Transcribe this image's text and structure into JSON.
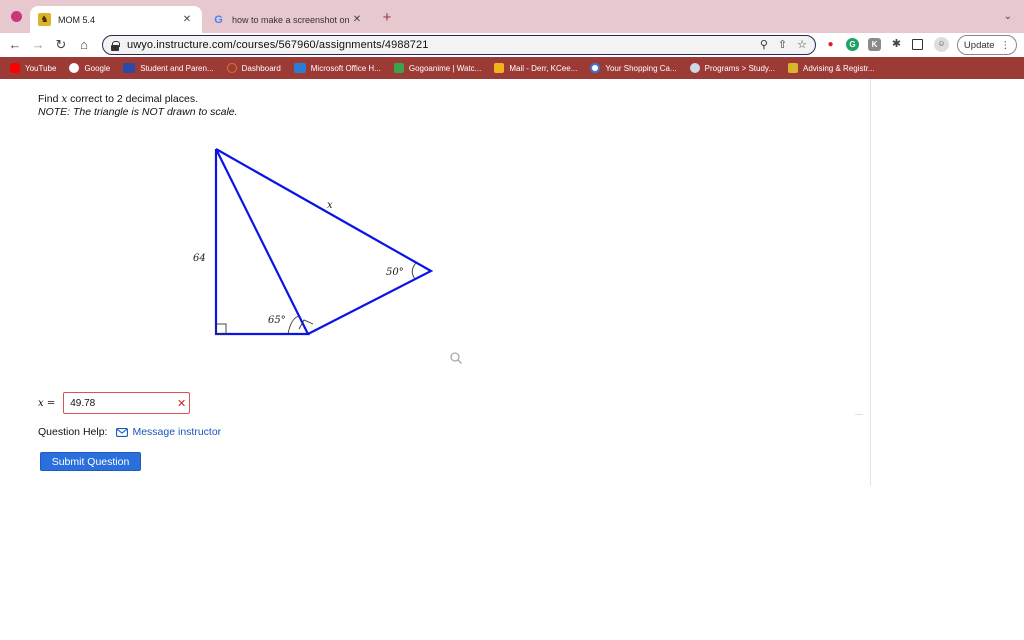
{
  "browser": {
    "tabs": [
      {
        "title": "MOM 5.4",
        "active": true,
        "favicon": "wyoming-cowboy-icon"
      },
      {
        "title": "how to make a screenshot on",
        "active": false,
        "favicon": "google-icon"
      }
    ],
    "url": "uwyo.instructure.com/courses/567960/assignments/4988721",
    "update_label": "Update",
    "bookmarks": [
      {
        "label": "YouTube",
        "icon": "youtube-icon",
        "color": "#ff0000"
      },
      {
        "label": "Google",
        "icon": "google-icon",
        "color": "#ffffff"
      },
      {
        "label": "Student and Paren...",
        "icon": "sis-icon",
        "color": "#2b4aa8"
      },
      {
        "label": "Dashboard",
        "icon": "dashboard-icon",
        "color": "#e1732e"
      },
      {
        "label": "Microsoft Office H...",
        "icon": "office-icon",
        "color": "#2b7cd3"
      },
      {
        "label": "Gogoanime | Watc...",
        "icon": "gogoanime-icon",
        "color": "#3aa34b"
      },
      {
        "label": "Mail - Derr, KCee...",
        "icon": "outlook-grid-icon",
        "color": "#f2b21c"
      },
      {
        "label": "Your Shopping Ca...",
        "icon": "shopping-icon",
        "color": "#3a7bd5"
      },
      {
        "label": "Programs > Study...",
        "icon": "globe-icon",
        "color": "#4a90d9"
      },
      {
        "label": "Advising & Registr...",
        "icon": "wyoming-cowboy-icon",
        "color": "#d8b52a"
      }
    ]
  },
  "question": {
    "prompt": "Find x correct to 2 decimal places.",
    "prompt_pre": "Find ",
    "prompt_var": "x",
    "prompt_post": " correct to 2 decimal places.",
    "note": "NOTE: The triangle is NOT drawn to scale.",
    "labels": {
      "side_left": "64",
      "side_x": "x",
      "angle_right": "50°",
      "angle_bottom": "65°"
    },
    "line_color": "#0a14e6"
  },
  "answer": {
    "variable_label": "x =",
    "value": "49.78",
    "status": "incorrect",
    "status_color": "#d62020"
  },
  "help": {
    "label": "Question Help:",
    "link": "Message instructor"
  },
  "submit_label": "Submit Question"
}
